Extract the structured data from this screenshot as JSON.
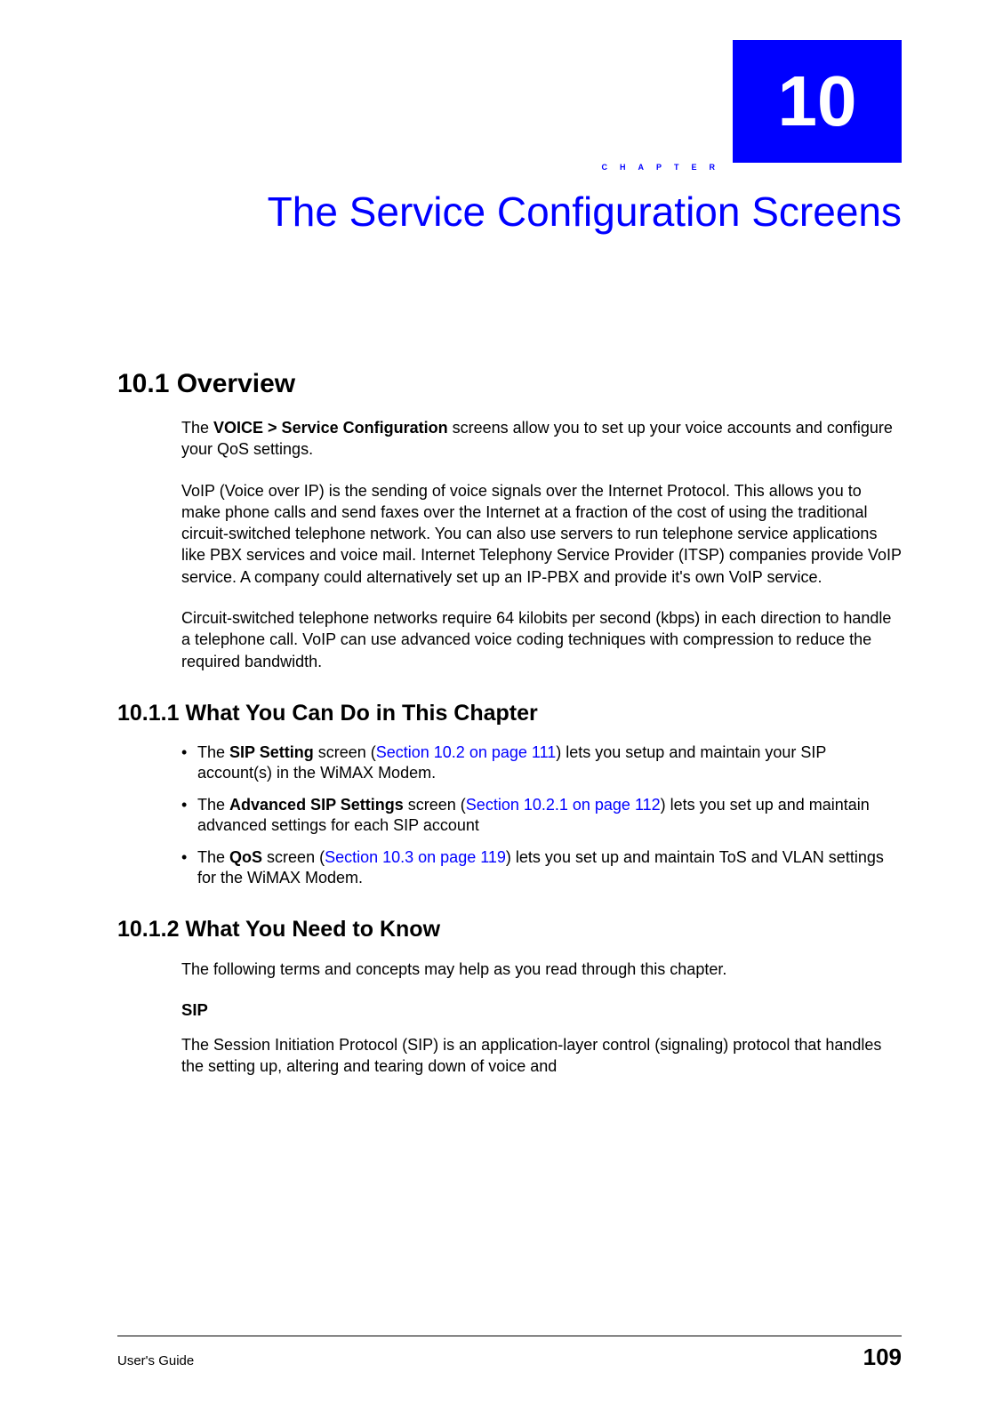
{
  "chapter": {
    "number": "10",
    "label_small": "CHAPTER",
    "title": "The Service Configuration Screens"
  },
  "sections": {
    "s10_1": {
      "heading": "10.1  Overview",
      "p1_a": "The ",
      "p1_b": "VOICE > Service Configuration",
      "p1_c": " screens allow you to set up your voice accounts and configure your QoS settings.",
      "p2": "VoIP (Voice over IP) is the sending of voice signals over the Internet Protocol. This allows you to make phone calls and send faxes over the Internet at a fraction of the cost of using the traditional circuit-switched telephone network. You can also use servers to run telephone service applications like PBX services and voice mail. Internet Telephony Service Provider (ITSP) companies provide VoIP service. A company could alternatively set up an IP-PBX and provide it's own VoIP service.",
      "p3": "Circuit-switched telephone networks require 64 kilobits per second (kbps) in each direction to handle a telephone call. VoIP can use advanced voice coding techniques with compression to reduce the required bandwidth."
    },
    "s10_1_1": {
      "heading": "10.1.1  What You Can Do in This Chapter",
      "items": [
        {
          "a": "The ",
          "b": "SIP Setting",
          "c": " screen (",
          "link": "Section 10.2 on page 111",
          "d": ") lets you setup and maintain your SIP account(s) in the WiMAX Modem."
        },
        {
          "a": "The ",
          "b": "Advanced SIP Settings",
          "c": " screen (",
          "link": "Section 10.2.1 on page 112",
          "d": ") lets you set up and maintain advanced settings for each SIP account"
        },
        {
          "a": "The ",
          "b": "QoS",
          "c": " screen (",
          "link": "Section 10.3 on page 119",
          "d": ") lets you set up and maintain ToS and VLAN settings for the WiMAX Modem."
        }
      ]
    },
    "s10_1_2": {
      "heading": "10.1.2  What You Need to Know",
      "p1": "The following terms and concepts may help as you read through this chapter.",
      "sub_head": "SIP",
      "p2": "The Session Initiation Protocol (SIP) is an application-layer control (signaling) protocol that handles the setting up, altering and tearing down of voice and"
    }
  },
  "footer": {
    "left": "User's Guide",
    "right": "109"
  }
}
